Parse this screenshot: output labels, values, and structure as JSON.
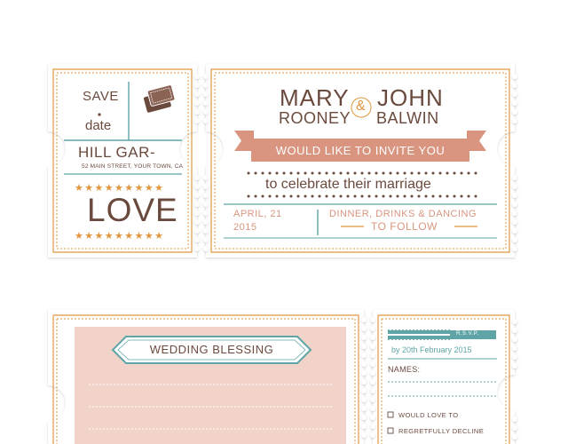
{
  "colors": {
    "brown": "#6b4a3e",
    "salmon": "#d9957f",
    "teal": "#5fa5a7",
    "orange": "#e1963f",
    "pink_panel": "#f2d3c9",
    "ticket_bg": "#ffffff"
  },
  "ticket1": {
    "stub": {
      "save": "SAVE",
      "date": "date",
      "icon": "ticket-icon",
      "venue": "HILL GAR-",
      "address": "52 MAIN STREET, YOUR TOWN, CA",
      "stars_top": "★★★★★★★★★",
      "love": "LOVE",
      "stars_bottom": "★★★★★★★★★"
    },
    "main": {
      "name1_first": "MARY",
      "name1_last": "ROONEY",
      "ampersand": "&",
      "name2_first": "JOHN",
      "name2_last": "BALWIN",
      "banner": "WOULD LIKE TO INVITE YOU",
      "celebrate": "to celebrate their marriage",
      "date_line1": "APRIL, 21",
      "date_line2": "2015",
      "event_line1": "DINNER, DRINKS & DANCING",
      "event_line2": "TO FOLLOW"
    }
  },
  "ticket2": {
    "blessing_title": "WEDDING BLESSING",
    "rsvp": {
      "label": "R.S.V.P.",
      "deadline": "by 20th February 2015",
      "names": "NAMES:",
      "options": [
        "WOULD LOVE TO",
        "REGRETFULLY DECLINE"
      ]
    }
  }
}
